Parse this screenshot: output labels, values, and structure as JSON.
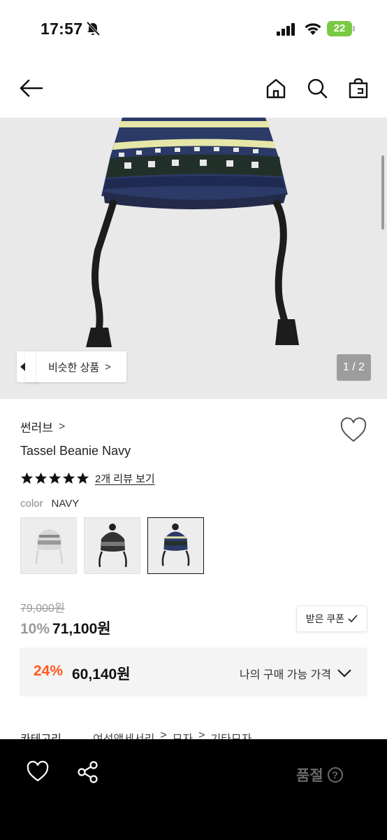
{
  "status_bar": {
    "time": "17:57",
    "battery": "22",
    "battery_color": "#7ac943"
  },
  "nav": {
    "icons": [
      "arrow-left-icon",
      "home-icon",
      "search-icon",
      "shopping-bag-icon"
    ]
  },
  "product_image": {
    "similar_label": "비슷한 상품",
    "similar_chevron": ">",
    "page_indicator": "1 / 2"
  },
  "product": {
    "brand": "썬러브",
    "brand_chevron": ">",
    "title": "Tassel Beanie Navy",
    "rating_stars": 5,
    "review_link": "2개 리뷰 보기",
    "color_label": "color",
    "color_value": "NAVY",
    "swatches": [
      "grey",
      "black",
      "navy"
    ],
    "selected_swatch": "navy"
  },
  "price": {
    "original": "79,000원",
    "discount": "10%",
    "sale": "71,100원",
    "coupon_label": "받은 쿠폰",
    "member_discount": "24%",
    "member_price": "60,140원",
    "member_label": "나의 구매 가능 가격",
    "accent_color": "#ff5a1f"
  },
  "category": {
    "label": "카테고리",
    "path": [
      "여성액세서리",
      ">",
      "모자",
      ">",
      "기타모자"
    ]
  },
  "bottom_bar": {
    "status": "품절",
    "help": "?"
  }
}
